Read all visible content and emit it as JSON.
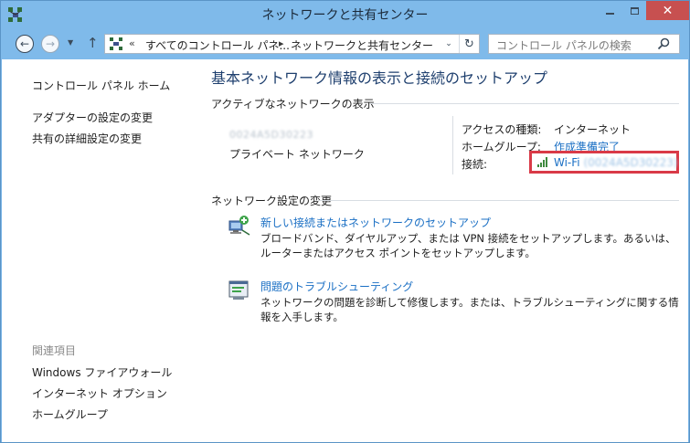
{
  "window": {
    "title": "ネットワークと共有センター",
    "close_glyph": "✕"
  },
  "nav": {
    "back_glyph": "←",
    "forward_glyph": "→",
    "recent_glyph": "▼",
    "up_glyph": "↑",
    "breadcrumb_prefix": "«",
    "breadcrumb": [
      "すべてのコントロール パネ...",
      "ネットワークと共有センター"
    ],
    "breadcrumb_sep": "▸",
    "dropdown_glyph": "⌄",
    "refresh_glyph": "↻",
    "search_placeholder": "コントロール パネルの検索"
  },
  "sidebar": {
    "links": [
      "コントロール パネル ホーム",
      "アダプターの設定の変更",
      "共有の詳細設定の変更"
    ],
    "related_heading": "関連項目",
    "related_links": [
      "Windows ファイアウォール",
      "インターネット オプション",
      "ホームグループ"
    ]
  },
  "main": {
    "title": "基本ネットワーク情報の表示と接続のセットアップ",
    "active_heading": "アクティブなネットワークの表示",
    "network_name": "0024A5D30223",
    "network_type": "プライベート ネットワーク",
    "access_label": "アクセスの種類:",
    "access_value": "インターネット",
    "homegroup_label": "ホームグループ:",
    "homegroup_value": "作成準備完了",
    "connection_label": "接続:",
    "connection_value": "Wi-Fi",
    "connection_ssid": "(0024A5D30223)",
    "change_heading": "ネットワーク設定の変更",
    "tasks": [
      {
        "link": "新しい接続またはネットワークのセットアップ",
        "desc": "ブロードバンド、ダイヤルアップ、または VPN 接続をセットアップします。あるいは、ルーターまたはアクセス ポイントをセットアップします。"
      },
      {
        "link": "問題のトラブルシューティング",
        "desc": "ネットワークの問題を診断して修復します。または、トラブルシューティングに関する情報を入手します。"
      }
    ]
  },
  "colors": {
    "link": "#1a6fc4",
    "title": "#1e3f6e",
    "highlight_box": "#d93a47",
    "close_button": "#c75050",
    "frame": "#7fbaea"
  }
}
